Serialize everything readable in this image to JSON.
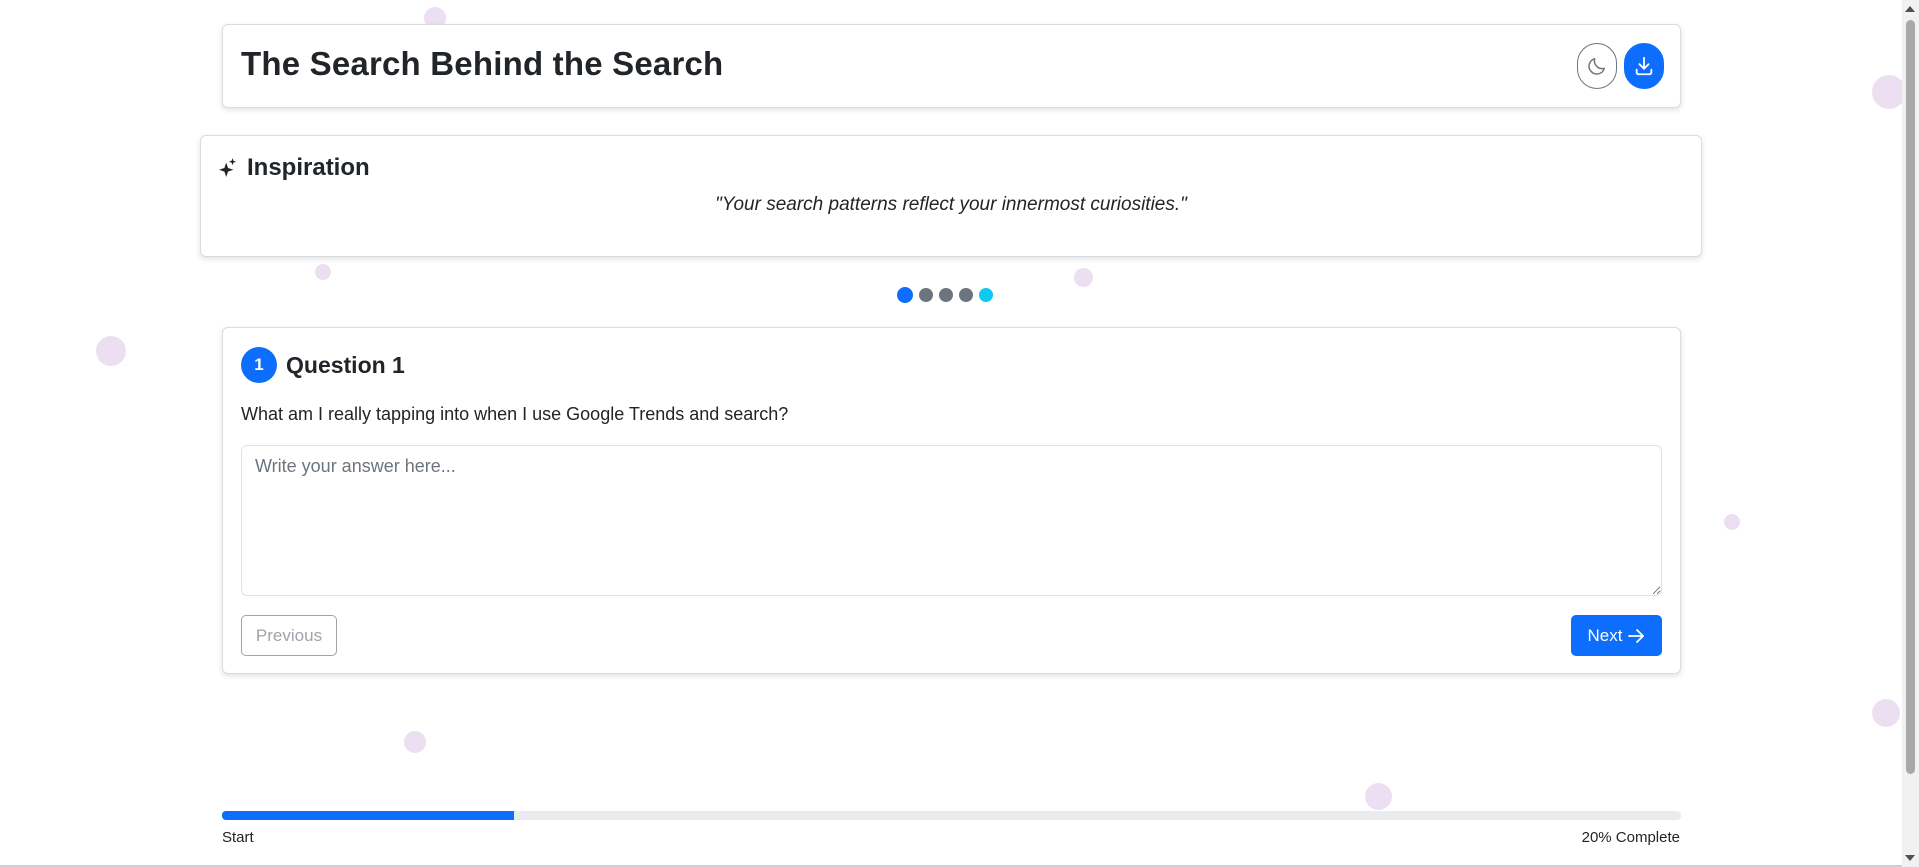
{
  "header": {
    "title": "The Search Behind the Search"
  },
  "inspiration": {
    "title": "Inspiration",
    "quote": "\"Your search patterns reflect your innermost curiosities.\""
  },
  "step_dots": {
    "count": 5,
    "active_index": 0,
    "colors": [
      "#0d6efd",
      "#6c757d",
      "#6c757d",
      "#6c757d",
      "#0dcaf0"
    ]
  },
  "question": {
    "number": "1",
    "title": "Question 1",
    "text": "What am I really tapping into when I use Google Trends and search?",
    "answer_placeholder": "Write your answer here...",
    "answer_value": "",
    "previous_label": "Previous",
    "next_label": "Next"
  },
  "progress": {
    "start_label": "Start",
    "complete_label": "20% Complete",
    "percent": 20
  },
  "colors": {
    "primary": "#0d6efd",
    "secondary": "#6c757d",
    "info": "#0dcaf0",
    "bubble": "#e6d6ee"
  },
  "icons": {
    "theme_toggle": "moon-icon",
    "download": "download-icon",
    "inspiration": "sparkles-icon",
    "next": "arrow-right-icon"
  }
}
